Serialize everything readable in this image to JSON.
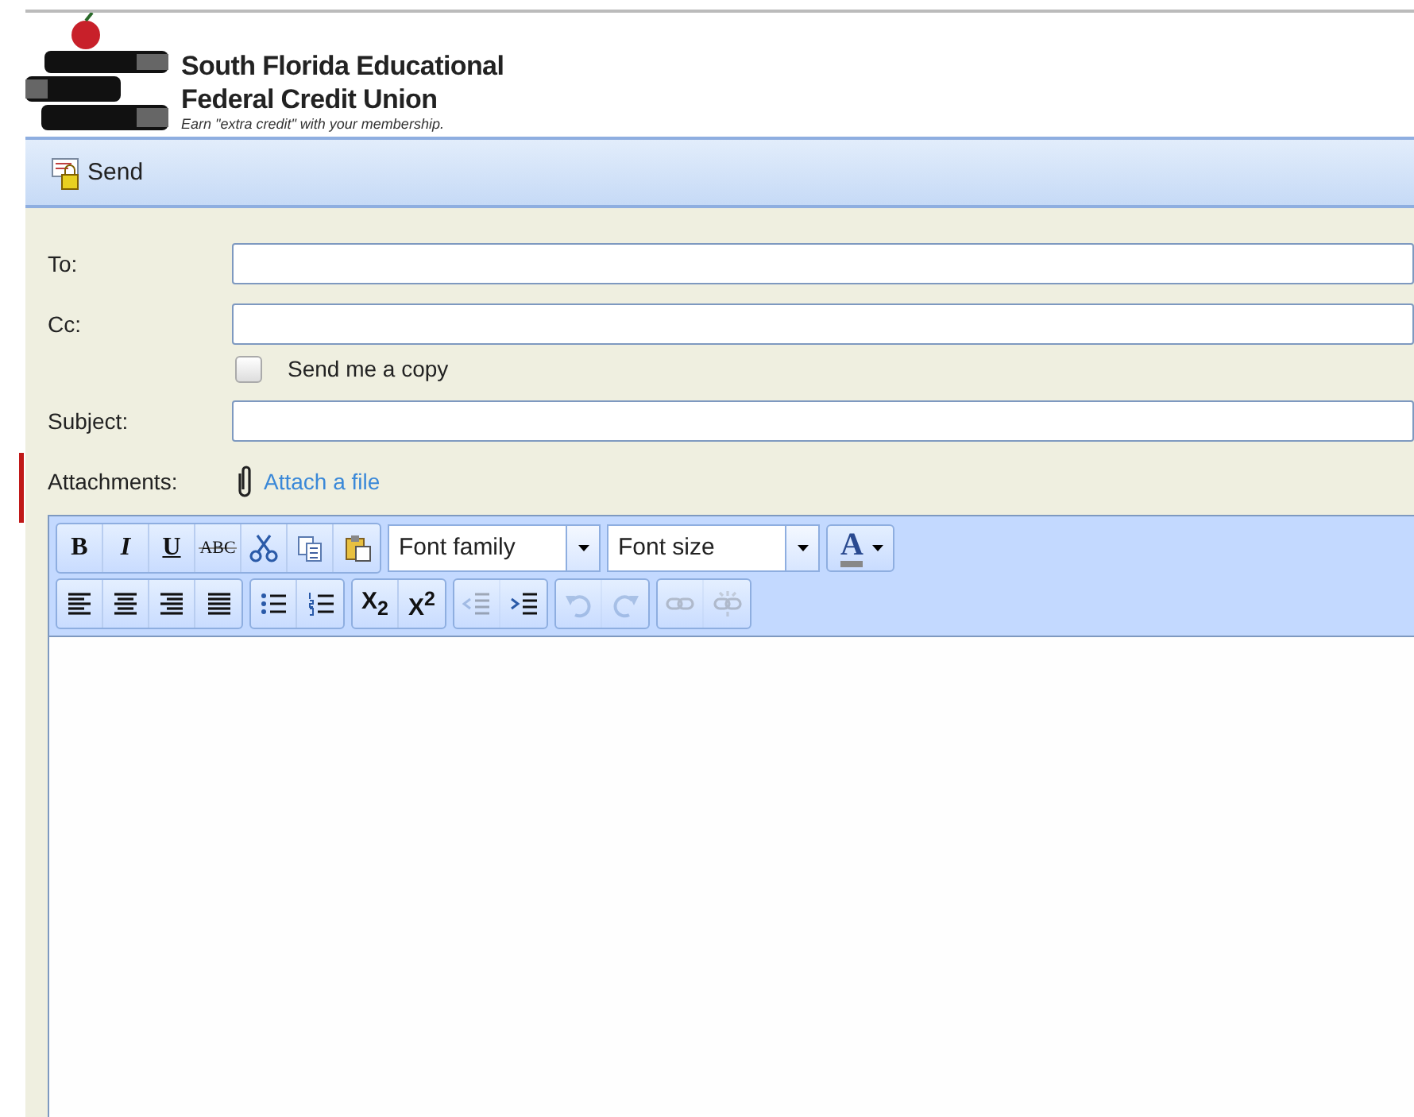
{
  "header": {
    "name_line1": "South Florida Educational",
    "name_line2": "Federal Credit Union",
    "tagline": "Earn \"extra credit\" with your membership."
  },
  "toolbar": {
    "send_label": "Send"
  },
  "form": {
    "to_label": "To:",
    "cc_label": "Cc:",
    "copy_label": "Send me a copy",
    "copy_checked": false,
    "subject_label": "Subject:",
    "attachments_label": "Attachments:",
    "attach_link": "Attach a file"
  },
  "editor": {
    "row1": [
      [
        {
          "kind": "bold",
          "label": "B",
          "disabled": false
        },
        {
          "kind": "italic",
          "label": "I",
          "disabled": false
        },
        {
          "kind": "underline",
          "label": "U",
          "disabled": false
        },
        {
          "kind": "strike",
          "label": "ABC",
          "disabled": false
        },
        {
          "kind": "cut",
          "disabled": false
        },
        {
          "kind": "copy",
          "disabled": false
        },
        {
          "kind": "paste",
          "disabled": false
        }
      ]
    ],
    "font_family": "Font family",
    "font_size": "Font size",
    "color_label": "A",
    "row2": [
      [
        {
          "kind": "align-left",
          "disabled": false
        },
        {
          "kind": "align-center",
          "disabled": false
        },
        {
          "kind": "align-right",
          "disabled": false
        },
        {
          "kind": "justify",
          "disabled": false
        }
      ],
      [
        {
          "kind": "bullets",
          "disabled": false
        },
        {
          "kind": "numbers",
          "disabled": false
        }
      ],
      [
        {
          "kind": "subscript",
          "label": "X$_{2}$",
          "disabled": false
        },
        {
          "kind": "superscript",
          "label": "X$^{2}$",
          "disabled": false
        }
      ],
      [
        {
          "kind": "outdent",
          "disabled": true
        },
        {
          "kind": "indent",
          "disabled": false
        }
      ],
      [
        {
          "kind": "undo",
          "disabled": true
        },
        {
          "kind": "redo",
          "disabled": true
        }
      ],
      [
        {
          "kind": "link",
          "disabled": true
        },
        {
          "kind": "unlink",
          "disabled": true
        }
      ]
    ]
  }
}
